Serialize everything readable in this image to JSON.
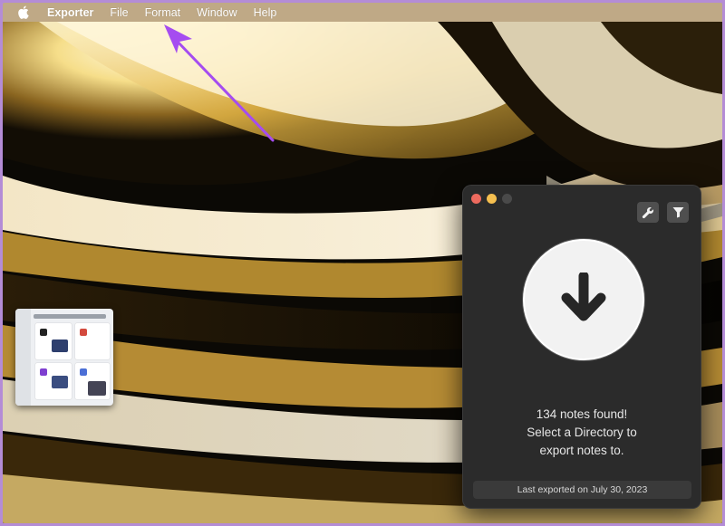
{
  "menubar": {
    "apple_icon": "apple-icon",
    "app_name": "Exporter",
    "items": [
      {
        "label": "File"
      },
      {
        "label": "Format"
      },
      {
        "label": "Window"
      },
      {
        "label": "Help"
      }
    ]
  },
  "annotation": {
    "arrow_color": "#a54cf0"
  },
  "window": {
    "toolbar": {
      "settings_icon": "wrench-icon",
      "filter_icon": "filter-icon"
    },
    "export_button_icon": "arrow-down-icon",
    "status_lines": [
      "134 notes found!",
      "Select a Directory to",
      "export notes to."
    ],
    "last_exported": "Last exported on July 30, 2023"
  },
  "colors": {
    "menubar_bg": "#bfa986",
    "window_bg": "#2b2b2b",
    "close": "#ed6a5e",
    "minimize": "#f5bf4f",
    "border": "#b48cd6"
  }
}
